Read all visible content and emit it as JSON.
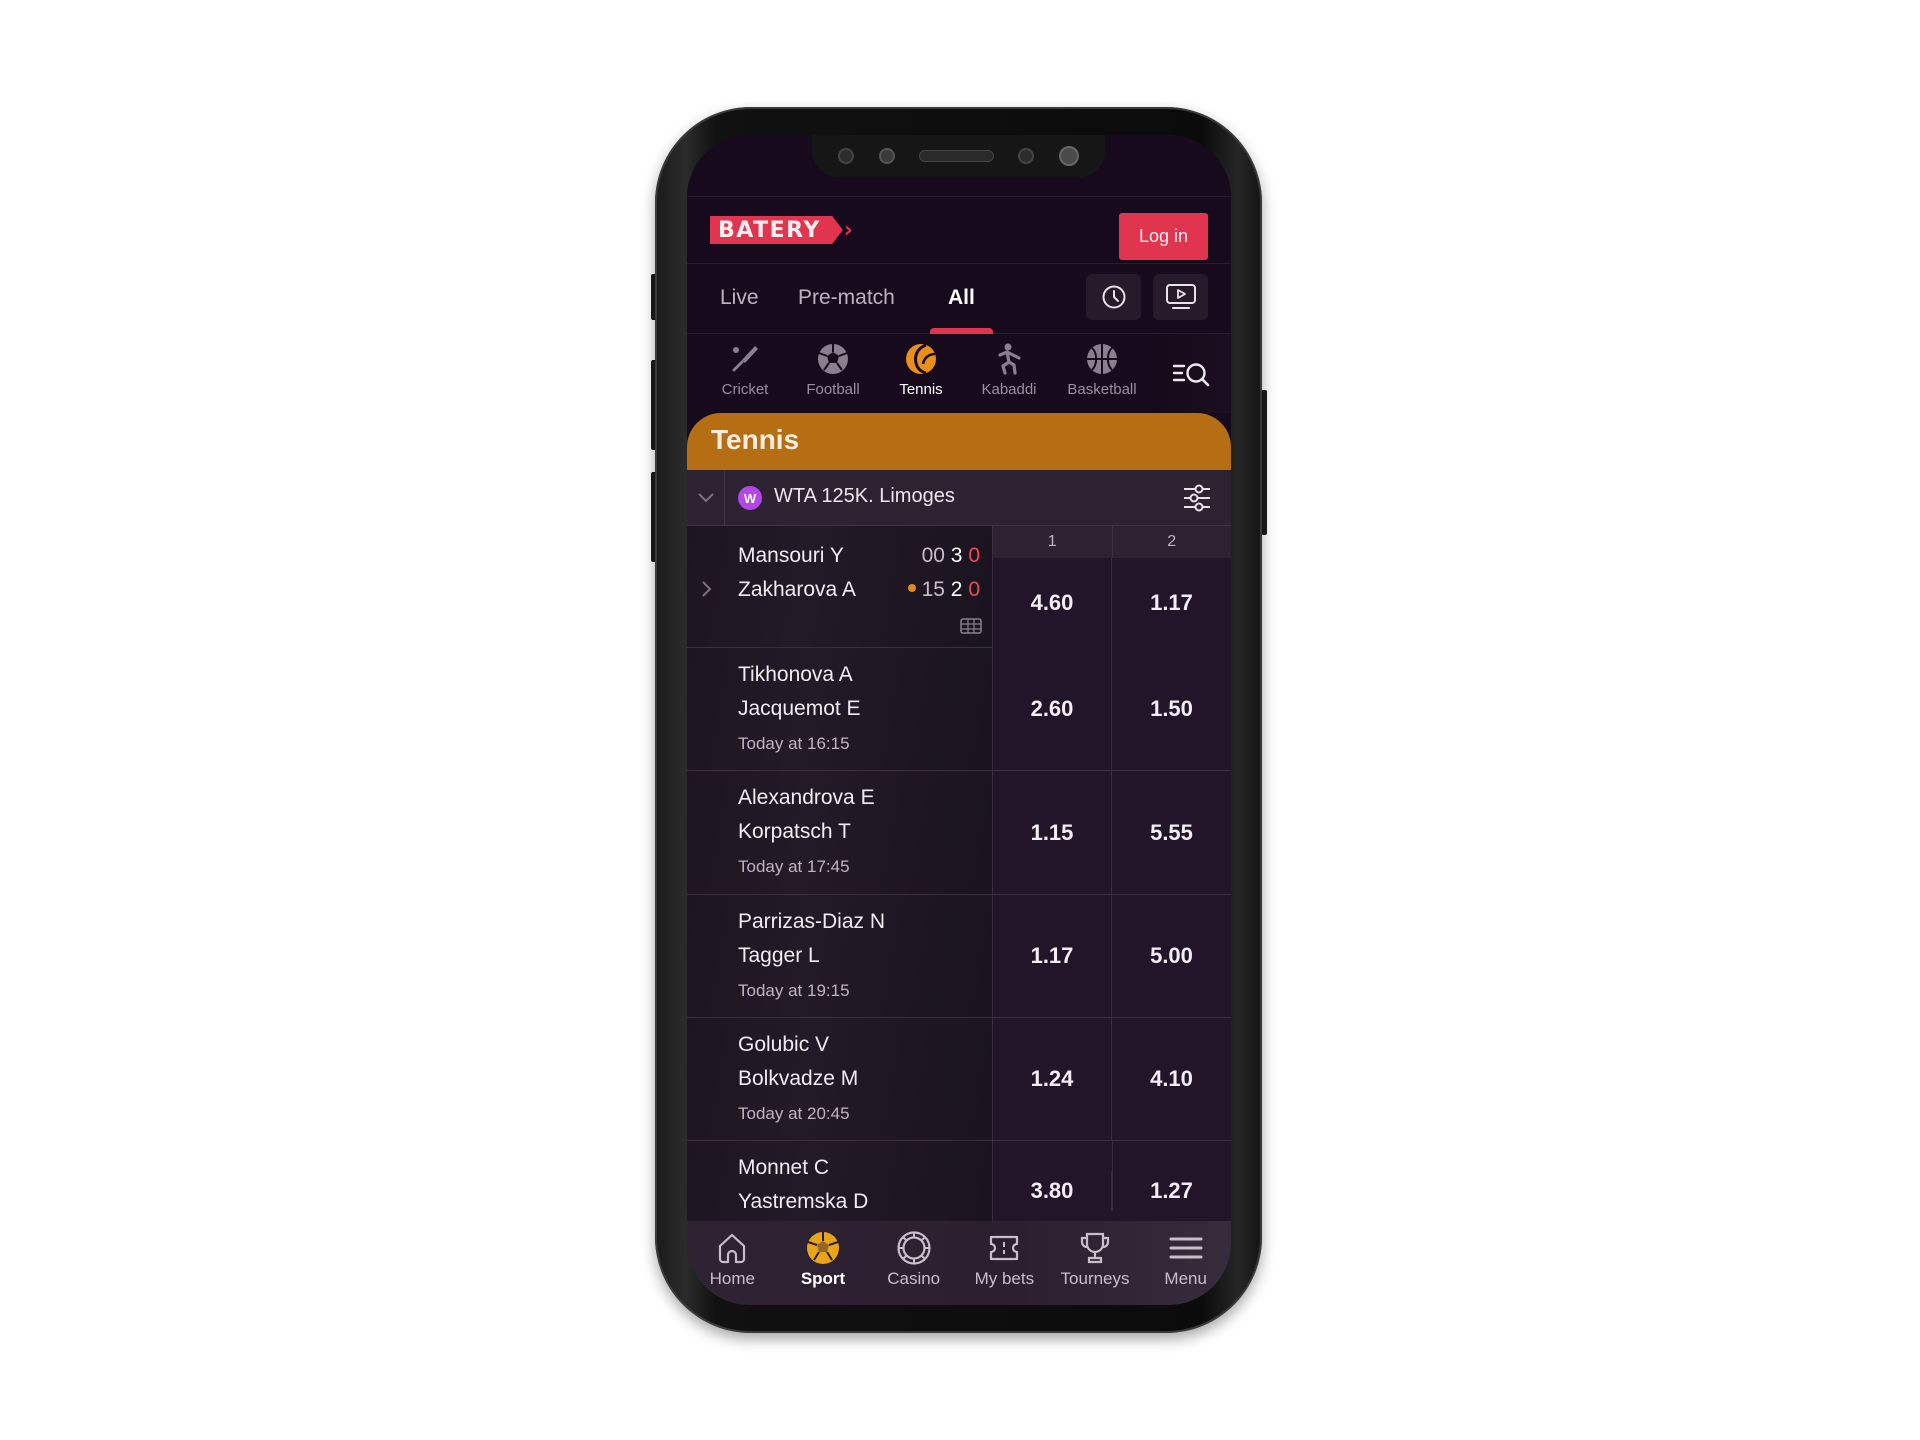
{
  "app": {
    "brand": "BATERY",
    "brand_color": "#e0344f",
    "accent_orange": "#b66e14"
  },
  "header": {
    "login_label": "Log in"
  },
  "tabs": [
    {
      "label": "Live",
      "active": false
    },
    {
      "label": "Pre-match",
      "active": false
    },
    {
      "label": "All",
      "active": true
    }
  ],
  "header_icons": [
    {
      "icon": "clock-icon",
      "label": "history"
    },
    {
      "icon": "tv-play-icon",
      "label": "live stream"
    }
  ],
  "sports": [
    {
      "label": "Cricket",
      "icon": "cricket-bat-icon",
      "active": false
    },
    {
      "label": "Football",
      "icon": "football-icon",
      "active": false
    },
    {
      "label": "Tennis",
      "icon": "tennis-ball-icon",
      "active": true
    },
    {
      "label": "Kabaddi",
      "icon": "kabaddi-icon",
      "active": false
    },
    {
      "label": "Basketball",
      "icon": "basketball-icon",
      "active": false
    }
  ],
  "section": {
    "title": "Tennis"
  },
  "league": {
    "badge": "W",
    "name": "WTA 125K. Limoges"
  },
  "odds_header": [
    "1",
    "2"
  ],
  "matches": [
    {
      "player1": "Mansouri Y",
      "player2": "Zakharova A",
      "live": true,
      "score1": {
        "game": "00",
        "set": "3",
        "current": "0"
      },
      "score2": {
        "game": "15",
        "set": "2",
        "current": "0"
      },
      "serving": 2,
      "odds": [
        "4.60",
        "1.17"
      ]
    },
    {
      "player1": "Tikhonova A",
      "player2": "Jacquemot E",
      "time": "Today at 16:15",
      "odds": [
        "2.60",
        "1.50"
      ]
    },
    {
      "player1": "Alexandrova E",
      "player2": "Korpatsch T",
      "time": "Today at 17:45",
      "odds": [
        "1.15",
        "5.55"
      ]
    },
    {
      "player1": "Parrizas-Diaz N",
      "player2": "Tagger L",
      "time": "Today at 19:15",
      "odds": [
        "1.17",
        "5.00"
      ]
    },
    {
      "player1": "Golubic V",
      "player2": "Bolkvadze M",
      "time": "Today at 20:45",
      "odds": [
        "1.24",
        "4.10"
      ]
    },
    {
      "player1": "Monnet C",
      "player2": "Yastremska D",
      "odds": [
        "3.80",
        "1.27"
      ]
    }
  ],
  "bottom_nav": [
    {
      "label": "Home",
      "icon": "home-icon",
      "active": false
    },
    {
      "label": "Sport",
      "icon": "sport-ball-icon",
      "active": true
    },
    {
      "label": "Casino",
      "icon": "casino-chip-icon",
      "active": false
    },
    {
      "label": "My bets",
      "icon": "ticket-icon",
      "active": false
    },
    {
      "label": "Tourneys",
      "icon": "trophy-icon",
      "active": false
    },
    {
      "label": "Menu",
      "icon": "menu-icon",
      "active": false
    }
  ]
}
